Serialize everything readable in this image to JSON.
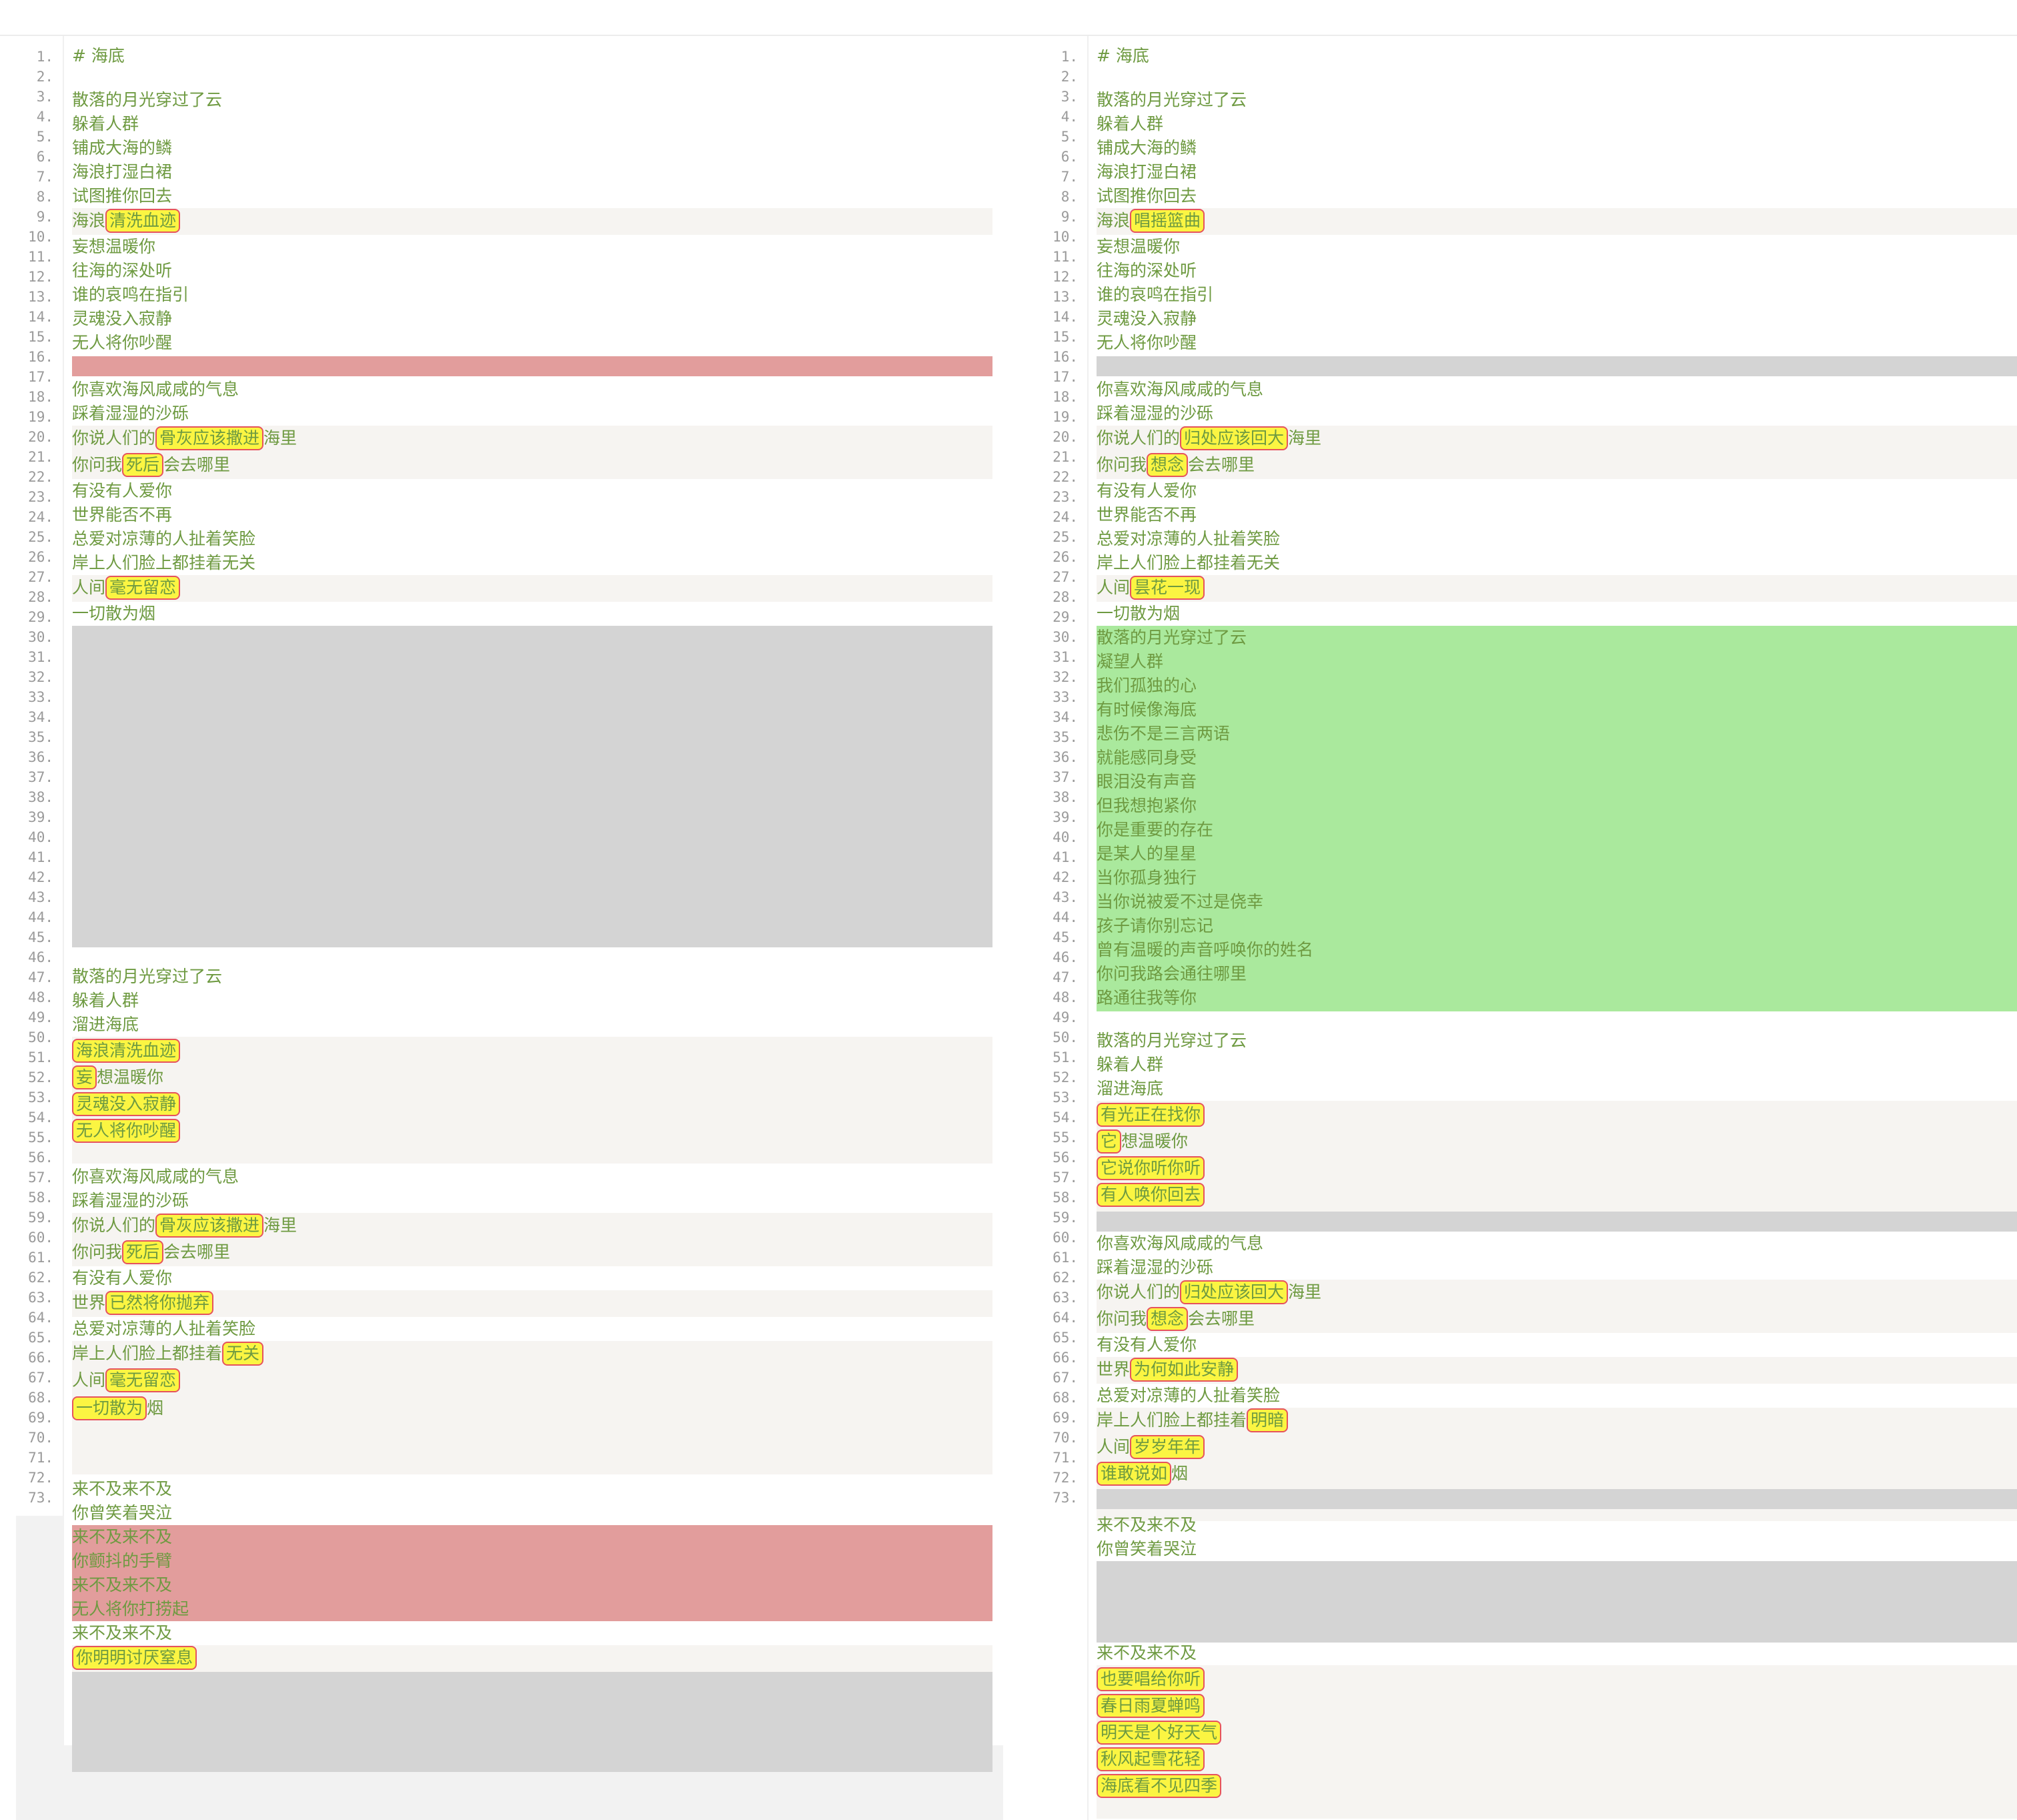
{
  "left": {
    "line_numbers": [
      "1.",
      "2.",
      "3.",
      "4.",
      "5.",
      "6.",
      "7.",
      "8.",
      "9.",
      "10.",
      "11.",
      "12.",
      "13.",
      "14.",
      "15.",
      "16.",
      "17.",
      "18.",
      "19.",
      "20.",
      "21.",
      "22.",
      "23.",
      "24.",
      "25.",
      "26.",
      "27.",
      "28.",
      "29.",
      "30.",
      "31.",
      "32.",
      "33.",
      "34.",
      "35.",
      "36.",
      "37.",
      "38.",
      "39.",
      "40.",
      "41.",
      "42.",
      "43.",
      "44.",
      "45.",
      "46.",
      "47.",
      "48.",
      "49.",
      "50.",
      "51.",
      "52.",
      "53.",
      "54.",
      "55.",
      "56.",
      "57.",
      "58.",
      "59.",
      "60.",
      "61.",
      "62.",
      "63.",
      "64.",
      "65.",
      "66.",
      "67.",
      "68.",
      "69.",
      "70.",
      "71.",
      "72.",
      "73."
    ],
    "lines": {
      "heading": "# 海底",
      "l3": "散落的月光穿过了云",
      "l4": "躲着人群",
      "l5": "铺成大海的鳞",
      "l6": "海浪打湿白裙",
      "l7": "试图推你回去",
      "l8a": "海浪",
      "l8b": "清洗血迹",
      "l9": "妄想温暖你",
      "l10": "往海的深处听",
      "l11": "谁的哀鸣在指引",
      "l12": "灵魂没入寂静",
      "l13": "无人将你吵醒",
      "l15": "你喜欢海风咸咸的气息",
      "l16": "踩着湿湿的沙砾",
      "l17a": "你说人们的",
      "l17b": "骨灰应该撒进",
      "l17c": "海里",
      "l18a": "你问我",
      "l18b": "死后",
      "l18c": "会去哪里",
      "l19": "有没有人爱你",
      "l20": "世界能否不再",
      "l21": "总爱对凉薄的人扯着笑脸",
      "l22": "岸上人们脸上都挂着无关",
      "l23a": "人间",
      "l23b": "毫无留恋",
      "l24": "一切散为烟",
      "l26": "散落的月光穿过了云",
      "l27": "躲着人群",
      "l28": "溜进海底",
      "l29": "海浪清洗血迹",
      "l30a": "妄",
      "l30b": "想温暖你",
      "l31": "灵魂没入寂静",
      "l32": "无人将你吵醒",
      "l34": "你喜欢海风咸咸的气息",
      "l35": "踩着湿湿的沙砾",
      "l36a": "你说人们的",
      "l36b": "骨灰应该撒进",
      "l36c": "海里",
      "l37a": "你问我",
      "l37b": "死后",
      "l37c": "会去哪里",
      "l38": "有没有人爱你",
      "l39a": "世界",
      "l39b": "已然将你抛弃",
      "l40": "总爱对凉薄的人扯着笑脸",
      "l41a": "岸上人们脸上都挂着",
      "l41b": "无关",
      "l42a": "人间",
      "l42b": "毫无留恋",
      "l43a": "一切散为",
      "l43b": "烟",
      "l45": "来不及来不及",
      "l46": "你曾笑着哭泣",
      "l47": "来不及来不及",
      "l48": "你颤抖的手臂",
      "l49": "来不及来不及",
      "l50": "无人将你打捞起",
      "l51": "来不及来不及",
      "l52": "你明明讨厌窒息"
    }
  },
  "right": {
    "lines": {
      "heading": "# 海底",
      "l3": "散落的月光穿过了云",
      "l4": "躲着人群",
      "l5": "铺成大海的鳞",
      "l6": "海浪打湿白裙",
      "l7": "试图推你回去",
      "l8a": "海浪",
      "l8b": "唱摇篮曲",
      "l9": "妄想温暖你",
      "l10": "往海的深处听",
      "l11": "谁的哀鸣在指引",
      "l12": "灵魂没入寂静",
      "l13": "无人将你吵醒",
      "l15": "你喜欢海风咸咸的气息",
      "l16": "踩着湿湿的沙砾",
      "l17a": "你说人们的",
      "l17b": "归处应该回大",
      "l17c": "海里",
      "l18a": "你问我",
      "l18b": "想念",
      "l18c": "会去哪里",
      "l19": "有没有人爱你",
      "l20": "世界能否不再",
      "l21": "总爱对凉薄的人扯着笑脸",
      "l22": "岸上人们脸上都挂着无关",
      "l23a": "人间",
      "l23b": "昙花一现",
      "l24": "一切散为烟",
      "added": [
        "散落的月光穿过了云",
        "凝望人群",
        "我们孤独的心",
        "有时候像海底",
        "悲伤不是三言两语",
        "就能感同身受",
        "眼泪没有声音",
        "但我想抱紧你",
        "你是重要的存在",
        "是某人的星星",
        "当你孤身独行",
        "当你说被爱不过是侥幸",
        "孩子请你别忘记",
        "曾有温暖的声音呼唤你的姓名",
        "你问我路会通往哪里",
        "路通往我等你"
      ],
      "l26": "散落的月光穿过了云",
      "l27": "躲着人群",
      "l28": "溜进海底",
      "l29": "有光正在找你",
      "l30a": "它",
      "l30b": "想温暖你",
      "l31": "它说你听你听",
      "l32": "有人唤你回去",
      "l34": "你喜欢海风咸咸的气息",
      "l35": "踩着湿湿的沙砾",
      "l36a": "你说人们的",
      "l36b": "归处应该回大",
      "l36c": "海里",
      "l37a": "你问我",
      "l37b": "想念",
      "l37c": "会去哪里",
      "l38": "有没有人爱你",
      "l39a": "世界",
      "l39b": "为何如此安静",
      "l40": "总爱对凉薄的人扯着笑脸",
      "l41a": "岸上人们脸上都挂着",
      "l41b": "明暗",
      "l42a": "人间",
      "l42b": "岁岁年年",
      "l43a": "谁敢说如",
      "l43b": "烟",
      "l45": "来不及来不及",
      "l46": "你曾笑着哭泣",
      "l51": "来不及来不及",
      "end": [
        "也要唱给你听",
        "春日雨夏蝉鸣",
        "明天是个好天气",
        "秋风起雪花轻",
        "海底看不见四季"
      ]
    }
  }
}
